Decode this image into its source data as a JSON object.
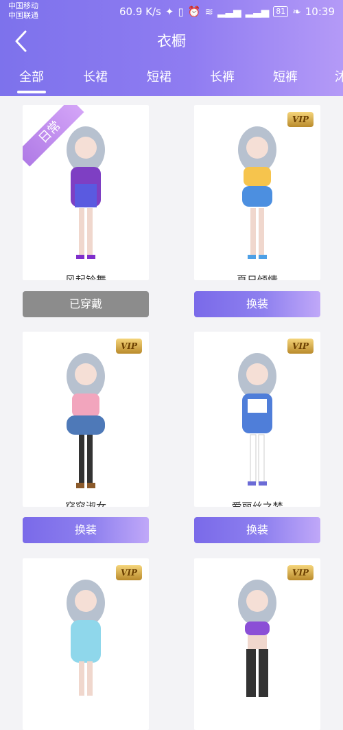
{
  "statusbar": {
    "carrier1": "中国移动",
    "carrier2": "中国联通",
    "speed": "60.9 K/s",
    "battery": "81",
    "time": "10:39"
  },
  "header": {
    "title": "衣橱",
    "tabs": [
      "全部",
      "长裙",
      "短裙",
      "长裤",
      "短裤",
      "沐"
    ]
  },
  "items": [
    {
      "name": "风起铃舞",
      "badge": "日常",
      "button": "已穿戴",
      "vip": false
    },
    {
      "name": "夏日倾情",
      "badge": "VIP",
      "button": "换装",
      "vip": true
    },
    {
      "name": "窈窕淑女",
      "badge": "VIP",
      "button": "换装",
      "vip": true
    },
    {
      "name": "爱丽丝之梦",
      "badge": "VIP",
      "button": "换装",
      "vip": true
    },
    {
      "name": "",
      "badge": "VIP",
      "button": "",
      "vip": true
    },
    {
      "name": "",
      "badge": "VIP",
      "button": "",
      "vip": true
    }
  ],
  "colors": {
    "header_start": "#7d72ec",
    "header_end": "#b49af7",
    "button_start": "#7a6ae9",
    "button_end": "#c0a8f8",
    "worn_button": "#8c8c8c"
  }
}
